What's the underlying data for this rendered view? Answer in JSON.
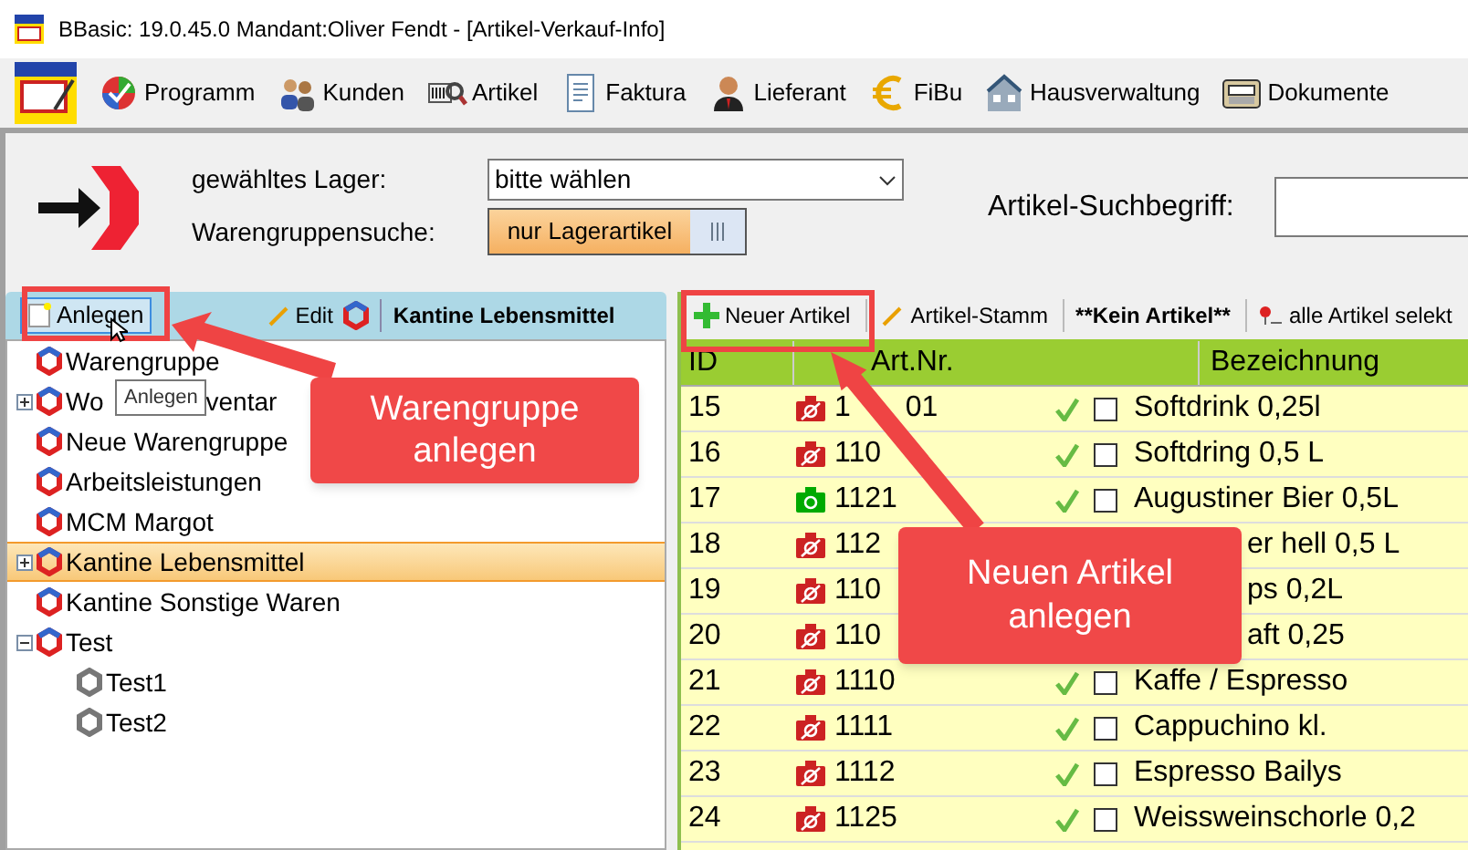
{
  "window": {
    "title": "BBasic: 19.0.45.0 Mandant:Oliver Fendt  - [Artikel-Verkauf-Info]"
  },
  "menu": [
    {
      "label": "Programm"
    },
    {
      "label": "Kunden"
    },
    {
      "label": "Artikel"
    },
    {
      "label": "Faktura"
    },
    {
      "label": "Lieferant"
    },
    {
      "label": "FiBu"
    },
    {
      "label": "Hausverwaltung"
    },
    {
      "label": "Dokumente"
    }
  ],
  "filter": {
    "lager_label": "gewähltes Lager:",
    "lager_value": "bitte wählen",
    "group_search_label": "Warengruppensuche:",
    "group_search_toggle": "nur Lagerartikel",
    "group_search_on": true,
    "search_label": "Artikel-Suchbegriff:"
  },
  "left_toolbar": {
    "add": "Anlegen",
    "edit": "Edit",
    "current_group": "Kantine Lebensmittel"
  },
  "tooltip": "Anlegen",
  "tree": [
    {
      "label": "Warengruppe",
      "selected": false
    },
    {
      "label": "Wo",
      "label_tail": "ventar",
      "selected": false,
      "expanded": false
    },
    {
      "label": "Neue Warengruppe",
      "selected": false
    },
    {
      "label": "Arbeitsleistungen",
      "selected": false
    },
    {
      "label": "MCM Margot",
      "selected": false
    },
    {
      "label": "Kantine Lebensmittel",
      "selected": true,
      "expanded": false
    },
    {
      "label": "Kantine Sonstige Waren",
      "selected": false
    },
    {
      "label": "Test",
      "selected": false,
      "expanded": true,
      "children": [
        {
          "label": "Test1",
          "selected": false
        },
        {
          "label": "Test2",
          "selected": false
        }
      ]
    }
  ],
  "right_toolbar": {
    "new": "Neuer Artikel",
    "master": "Artikel-Stamm",
    "current": "**Kein Artikel**",
    "select_all": "alle Artikel selekt"
  },
  "table": {
    "columns": [
      "ID",
      "Art.Nr.",
      "Bezeichnung"
    ],
    "rows": [
      {
        "id": "15",
        "has_photo": false,
        "art_nr": "1",
        "art_nr_tail": "01",
        "active": true,
        "checked": false,
        "name": "Softdrink 0,25l"
      },
      {
        "id": "16",
        "has_photo": false,
        "art_nr": "110",
        "active": true,
        "checked": false,
        "name": "Softdring 0,5 L"
      },
      {
        "id": "17",
        "has_photo": true,
        "art_nr": "1121",
        "active": true,
        "checked": false,
        "name": "Augustiner Bier 0,5L"
      },
      {
        "id": "18",
        "has_photo": false,
        "art_nr": "112",
        "name": "er hell  0,5 L",
        "name_cut": true
      },
      {
        "id": "19",
        "has_photo": false,
        "art_nr": "110",
        "name": "ps 0,2L",
        "name_cut": true
      },
      {
        "id": "20",
        "has_photo": false,
        "art_nr": "110",
        "name": "aft 0,25",
        "name_cut": true
      },
      {
        "id": "21",
        "has_photo": false,
        "art_nr": "1110",
        "active": true,
        "checked": false,
        "name": "Kaffe / Espresso"
      },
      {
        "id": "22",
        "has_photo": false,
        "art_nr": "1111",
        "active": true,
        "checked": false,
        "name": "Cappuchino kl."
      },
      {
        "id": "23",
        "has_photo": false,
        "art_nr": "1112",
        "active": true,
        "checked": false,
        "name": "Espresso Bailys"
      },
      {
        "id": "24",
        "has_photo": false,
        "art_nr": "1125",
        "active": true,
        "checked": false,
        "name": "Weissweinschorle 0,2"
      }
    ]
  },
  "callouts": [
    {
      "text": "Warengruppe anlegen"
    },
    {
      "text": "Neuen Artikel anlegen"
    }
  ]
}
